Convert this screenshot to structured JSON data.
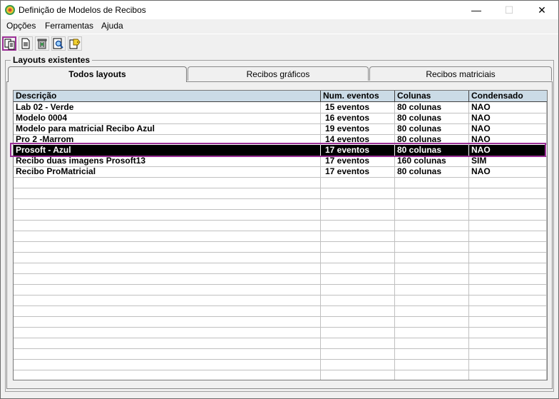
{
  "window": {
    "title": "Definição de Modelos de Recibos",
    "minimize": "—",
    "maximize": "☐",
    "close": "✕"
  },
  "menu": {
    "items": [
      {
        "label": "Opções"
      },
      {
        "label": "Ferramentas"
      },
      {
        "label": "Ajuda"
      }
    ]
  },
  "toolbar": {
    "buttons": [
      {
        "name": "new-copy-icon"
      },
      {
        "name": "document-icon"
      },
      {
        "name": "delete-trash-icon"
      },
      {
        "name": "preview-search-icon"
      },
      {
        "name": "tag-label-icon"
      }
    ]
  },
  "group": {
    "label": "Layouts existentes"
  },
  "tabs": [
    {
      "label": "Todos layouts",
      "active": true
    },
    {
      "label": "Recibos gráficos",
      "active": false
    },
    {
      "label": "Recibos matriciais",
      "active": false
    }
  ],
  "table": {
    "columns": [
      "Descrição",
      "Num. eventos",
      "Colunas",
      "Condensado"
    ],
    "rows": [
      [
        "Lab 02 - Verde",
        "15 eventos",
        "80 colunas",
        "NAO"
      ],
      [
        "Modelo 0004",
        "16 eventos",
        "80 colunas",
        "NAO"
      ],
      [
        "Modelo para matricial Recibo Azul",
        "19 eventos",
        "80 colunas",
        "NAO"
      ],
      [
        "Pro 2 -Marrom",
        "14 eventos",
        "80 colunas",
        "NAO"
      ],
      [
        "Prosoft - Azul",
        "17 eventos",
        "80 colunas",
        "NAO"
      ],
      [
        "Recibo duas imagens Prosoft13",
        "17 eventos",
        "160 colunas",
        "SIM"
      ],
      [
        "Recibo ProMatricial",
        "17 eventos",
        "80 colunas",
        "NAO"
      ]
    ],
    "selected_row": 4
  },
  "colors": {
    "highlight": "#9b2f96",
    "header_bg": "#cbdbe6",
    "selected_bg": "#000000"
  }
}
